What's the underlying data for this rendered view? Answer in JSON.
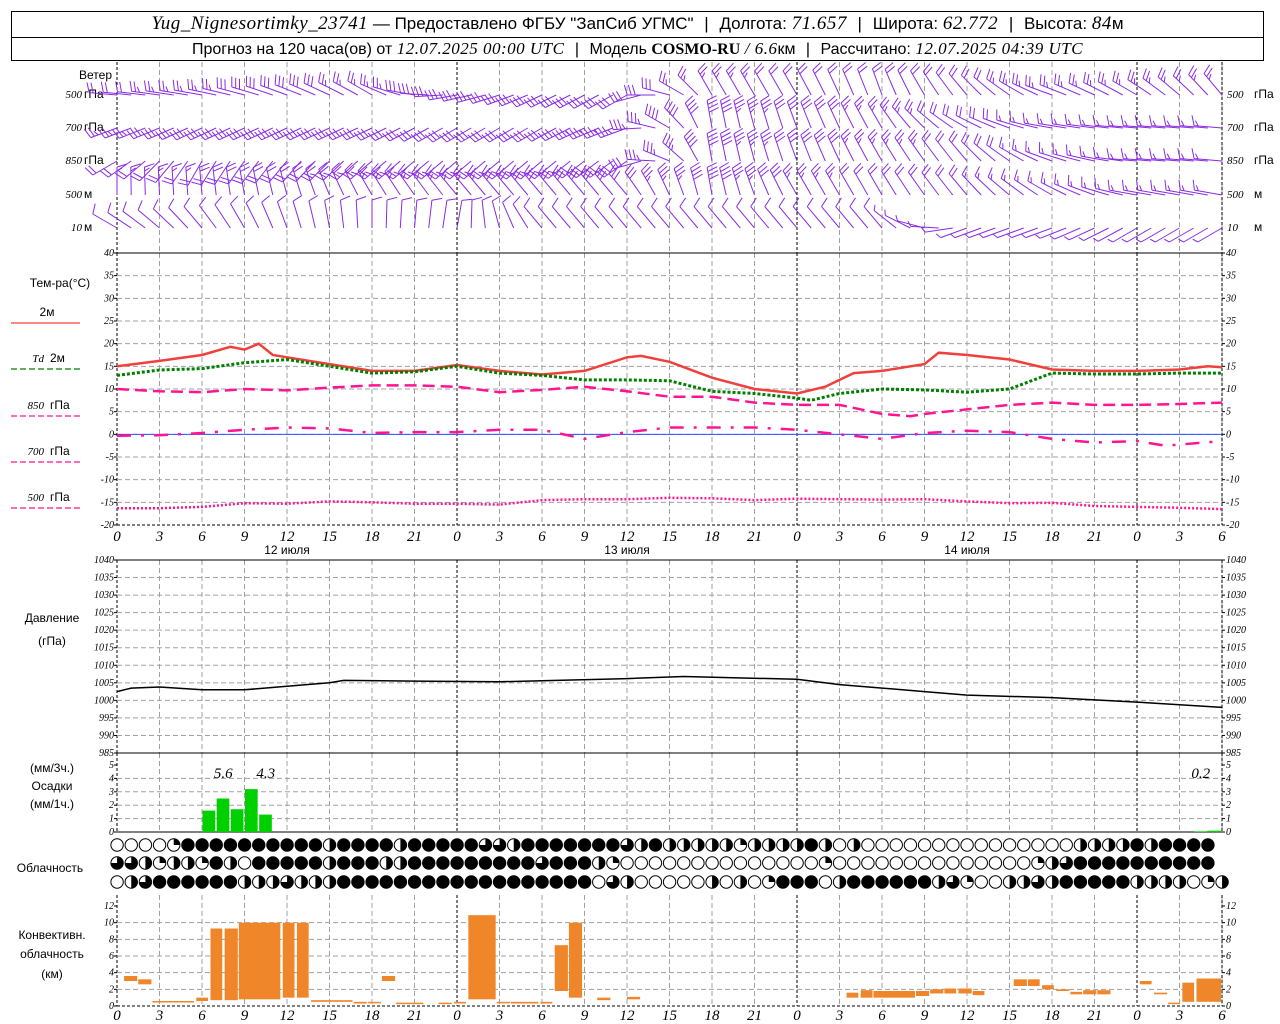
{
  "header": {
    "station": "Yug_Nignesortimky_23741",
    "provider": "— Предоставлено ФГБУ \"ЗапСиб УГМС\"",
    "lon_label": "Долгота:",
    "lon": "71.657",
    "lat_label": "Широта:",
    "lat": "62.772",
    "alt_label": "Высота:",
    "alt": "84",
    "alt_unit": "м",
    "forecast_prefix": "Прогноз на 120 часа(ов) от",
    "forecast_start": "12.07.2025 00:00 UTC",
    "model_label": "Модель",
    "model": "COSMO-RU",
    "model_res": "/ 6.6",
    "model_res_unit": "км",
    "calc_label": "Рассчитано:",
    "calc_time": "12.07.2025 04:39 UTC"
  },
  "labels": {
    "wind": "Ветер",
    "temp": "Тем-ра(°C)",
    "t2m": "2м",
    "td": "Td",
    "td2m": "2м",
    "p850": "850",
    "p700": "700",
    "p500": "500",
    "gpa": "гПа",
    "pressure": "Давление",
    "pressure_unit": "(гПа)",
    "precip_3h": "(мм/3ч.)",
    "precip": "Осадки",
    "precip_1h": "(мм/1ч.)",
    "clouds": "Облачность",
    "conv1": "Конвективн.",
    "conv2": "облачность",
    "conv3": "(км)"
  },
  "colors": {
    "wind": "#8a2be2",
    "t2m": "#f0403c",
    "td": "#008000",
    "upper": "#ff1493",
    "zero_line": "#3050ff",
    "precip": "#00d000",
    "convective": "#f0862a",
    "grid": "#a0a0a0"
  },
  "hour_ticks": [
    "0",
    "3",
    "6",
    "9",
    "12",
    "15",
    "18",
    "21",
    "0",
    "3",
    "6",
    "9",
    "12",
    "15",
    "18",
    "21",
    "0",
    "3",
    "6",
    "9",
    "12",
    "15",
    "18",
    "21",
    "0",
    "3",
    "6"
  ],
  "date_labels": [
    {
      "hour": 12,
      "text": "12 июля"
    },
    {
      "hour": 36,
      "text": "13 июля"
    },
    {
      "hour": 60,
      "text": "14 июля"
    }
  ],
  "chart_data": [
    {
      "type": "wind-barbs",
      "title": "Ветер",
      "x_hours_step": 6,
      "levels": [
        {
          "label_num": "500",
          "label_unit": "гПа",
          "dir": [
            275,
            280,
            290,
            300,
            260,
            245,
            240,
            330,
            330,
            340,
            320,
            290,
            300,
            320
          ],
          "speed": [
            8,
            10,
            12,
            10,
            12,
            12,
            12,
            10,
            8,
            7,
            8,
            10,
            10,
            10
          ]
        },
        {
          "label_num": "700",
          "label_unit": "гПа",
          "dir": [
            250,
            245,
            245,
            245,
            240,
            240,
            250,
            350,
            340,
            330,
            300,
            280,
            275,
            275
          ],
          "speed": [
            10,
            12,
            12,
            12,
            12,
            12,
            14,
            16,
            12,
            10,
            8,
            6,
            6,
            6
          ]
        },
        {
          "label_num": "850",
          "label_unit": "гПа",
          "dir": [
            240,
            210,
            220,
            230,
            230,
            230,
            235,
            350,
            340,
            330,
            320,
            290,
            275,
            275
          ],
          "speed": [
            8,
            8,
            8,
            10,
            10,
            10,
            12,
            16,
            12,
            10,
            8,
            6,
            6,
            6
          ]
        },
        {
          "label_num": "500",
          "label_unit": "м",
          "dir": [
            360,
            355,
            345,
            330,
            320,
            320,
            320,
            350,
            330,
            330,
            320,
            300,
            280,
            280
          ],
          "speed": [
            6,
            7,
            7,
            9,
            10,
            12,
            12,
            16,
            10,
            8,
            7,
            6,
            6,
            6
          ]
        },
        {
          "label_num": "10",
          "label_unit": "м",
          "dir": [
            300,
            320,
            340,
            360,
            370,
            320,
            320,
            320,
            320,
            320,
            250,
            250,
            240,
            240
          ],
          "speed": [
            3,
            3,
            3,
            4,
            4,
            3,
            4,
            4,
            3,
            3,
            2,
            2,
            2,
            2
          ]
        }
      ]
    },
    {
      "type": "line",
      "title": "Тем-ра(°C)",
      "ylim": [
        -20,
        40
      ],
      "yticks": [
        "40",
        "35",
        "30",
        "25",
        "20",
        "15",
        "10",
        "5",
        "0",
        "-5",
        "-10",
        "-15",
        "-20"
      ],
      "grid": true,
      "series": [
        {
          "name": "2м",
          "style": "solid",
          "x": [
            0,
            3,
            6,
            8,
            9,
            10,
            11,
            12,
            15,
            18,
            21,
            24,
            27,
            30,
            33,
            36,
            37,
            39,
            42,
            45,
            48,
            50,
            52,
            54,
            57,
            58,
            60,
            63,
            66,
            69,
            72,
            75,
            77,
            78
          ],
          "y": [
            15,
            16.2,
            17.5,
            19.3,
            18.7,
            20,
            17.5,
            17,
            15.5,
            14,
            14,
            15.3,
            14,
            13.2,
            14,
            17,
            17.3,
            16,
            12.5,
            10,
            9,
            10.5,
            13.5,
            14,
            15.5,
            18,
            17.5,
            16.5,
            14.3,
            14,
            14,
            14.3,
            15,
            14.8
          ]
        },
        {
          "name": "Td 2м",
          "style": "dotted",
          "x": [
            0,
            3,
            6,
            9,
            12,
            15,
            18,
            21,
            24,
            27,
            30,
            33,
            36,
            39,
            42,
            45,
            48,
            49,
            51,
            54,
            57,
            60,
            63,
            66,
            69,
            72,
            75,
            78
          ],
          "y": [
            13,
            14.2,
            14.5,
            15.8,
            16.5,
            15,
            13.5,
            13.8,
            15,
            13.5,
            13,
            12,
            12,
            11.8,
            9.5,
            9,
            8,
            7.5,
            9,
            10,
            9.8,
            9.3,
            10,
            13.5,
            13.3,
            13.3,
            13.5,
            13.5
          ]
        },
        {
          "name": "850 гПа",
          "style": "dashed",
          "x": [
            0,
            3,
            6,
            9,
            12,
            15,
            18,
            21,
            24,
            27,
            30,
            33,
            36,
            39,
            42,
            45,
            48,
            51,
            54,
            56,
            57,
            60,
            63,
            66,
            69,
            72,
            75,
            78
          ],
          "y": [
            10,
            9.5,
            9.3,
            10,
            9.7,
            10.3,
            10.8,
            10.8,
            10.5,
            9.3,
            9.8,
            10.5,
            9.5,
            8.3,
            8.3,
            7,
            6.5,
            6.5,
            4.5,
            4,
            4.5,
            5.5,
            6.5,
            7,
            6.5,
            6.5,
            6.7,
            7
          ]
        },
        {
          "name": "700 гПа",
          "style": "dashdot",
          "x": [
            0,
            3,
            6,
            9,
            12,
            15,
            18,
            21,
            24,
            27,
            30,
            33,
            36,
            39,
            42,
            45,
            48,
            51,
            54,
            57,
            60,
            63,
            66,
            69,
            72,
            74,
            78
          ],
          "y": [
            -0.3,
            -0.2,
            0.3,
            1,
            1.5,
            1.3,
            0.3,
            0.5,
            0.5,
            1,
            1,
            -1,
            0.5,
            1.5,
            1.5,
            1.5,
            1,
            0,
            -1,
            0.3,
            0.8,
            0.5,
            -1,
            -1.8,
            -1.5,
            -2.5,
            -1.5
          ]
        },
        {
          "name": "500 гПа",
          "style": "fine-dotted",
          "x": [
            0,
            3,
            6,
            9,
            12,
            15,
            18,
            21,
            24,
            27,
            30,
            33,
            36,
            39,
            42,
            45,
            48,
            51,
            54,
            57,
            60,
            63,
            66,
            69,
            72,
            75,
            78
          ],
          "y": [
            -16.3,
            -16.3,
            -16,
            -15.2,
            -15.3,
            -14.8,
            -15,
            -15.3,
            -15.3,
            -15.5,
            -14.5,
            -14.3,
            -14.3,
            -14,
            -14.1,
            -14.5,
            -14.2,
            -14.3,
            -14.4,
            -14.3,
            -14.8,
            -15.2,
            -15.1,
            -15.8,
            -16,
            -16.2,
            -16.5
          ]
        }
      ]
    },
    {
      "type": "line",
      "title": "Давление (гПа)",
      "ylim": [
        985,
        1040
      ],
      "yticks": [
        "1040",
        "1035",
        "1030",
        "1025",
        "1020",
        "1015",
        "1010",
        "1005",
        "1000",
        "995",
        "990",
        "985"
      ],
      "grid": true,
      "series": [
        {
          "x": [
            0,
            1,
            3,
            6,
            9,
            12,
            15,
            16,
            21,
            27,
            30,
            36,
            40,
            48,
            51,
            57,
            60,
            66,
            72,
            78
          ],
          "y": [
            1002.5,
            1003.5,
            1003.8,
            1003,
            1003,
            1004,
            1005,
            1005.7,
            1005.5,
            1005.3,
            1005.6,
            1006.2,
            1006.8,
            1006,
            1004.5,
            1002.5,
            1001.5,
            1000.8,
            999.5,
            998
          ]
        }
      ]
    },
    {
      "type": "bar",
      "title": "Осадки",
      "ylim": [
        0,
        5
      ],
      "yticks": [
        "5",
        "4",
        "3",
        "2",
        "1",
        "0"
      ],
      "bars_1h": [
        {
          "start": 6,
          "value": 1.6
        },
        {
          "start": 7,
          "value": 2.5
        },
        {
          "start": 8,
          "value": 1.7
        },
        {
          "start": 9,
          "value": 3.2
        },
        {
          "start": 10,
          "value": 1.3
        },
        {
          "start": 76,
          "value": 0.05
        },
        {
          "start": 77,
          "value": 0.1
        }
      ],
      "sums_3h": [
        {
          "hour": 7.5,
          "text": "5.6"
        },
        {
          "hour": 10.5,
          "text": "4.3"
        },
        {
          "hour": 76.5,
          "text": "0.2"
        }
      ]
    },
    {
      "type": "table",
      "title": "Облачность",
      "encoding": "okta per hour 0..78 (0 clear, 2 quarter, 4 half, 6 three-quarter, 8 overcast)",
      "rows": [
        "000028888888888488884888886648888888648444442444484040000000000000004444848888",
        "664244284088888488844888888888688842000000000000002000000000000002468888888888",
        "046888888444644488888888888888888806400000404028880488888846200446488888444402 4"
      ]
    },
    {
      "type": "bar",
      "title": "Конвективн. облачность (км)",
      "ylim": [
        0,
        12
      ],
      "yticks": [
        "12",
        "10",
        "8",
        "6",
        "4",
        "2",
        "0"
      ],
      "bars": [
        [
          0.5,
          1.5,
          3.0,
          3.6
        ],
        [
          1.5,
          2.5,
          2.6,
          3.2
        ],
        [
          2.5,
          5.5,
          0.5,
          0.6
        ],
        [
          5.6,
          6.5,
          0.6,
          1.0
        ],
        [
          6.6,
          7.5,
          0.7,
          9.3
        ],
        [
          7.6,
          8.6,
          0.7,
          9.3
        ],
        [
          8.6,
          11.6,
          0.8,
          10
        ],
        [
          11.7,
          12.6,
          1.0,
          10
        ],
        [
          12.7,
          13.6,
          1.0,
          10
        ],
        [
          13.7,
          16.7,
          0.5,
          0.7
        ],
        [
          16.7,
          17.7,
          0.3,
          0.5
        ],
        [
          17.7,
          18.7,
          0.4,
          0.5
        ],
        [
          18.7,
          19.7,
          3.0,
          3.6
        ],
        [
          19.7,
          21.7,
          0.3,
          0.4
        ],
        [
          22.7,
          23.7,
          0.3,
          0.4
        ],
        [
          23.8,
          24.7,
          0.3,
          0.5
        ],
        [
          24.8,
          26.8,
          0.8,
          10.9
        ],
        [
          26.8,
          27.8,
          0.4,
          0.5
        ],
        [
          27.8,
          29.8,
          0.3,
          0.5
        ],
        [
          29.9,
          30.8,
          0.3,
          0.5
        ],
        [
          30.9,
          31.9,
          1.8,
          7.3
        ],
        [
          31.9,
          32.9,
          1.0,
          10
        ],
        [
          33.9,
          34.9,
          0.7,
          1.0
        ],
        [
          36,
          37,
          0.8,
          1.1
        ],
        [
          51.5,
          52.4,
          1.0,
          1.6
        ],
        [
          52.5,
          53.4,
          1.0,
          1.9
        ],
        [
          53.4,
          56.4,
          1.0,
          1.8
        ],
        [
          56.4,
          57.4,
          1.2,
          1.8
        ],
        [
          57.4,
          58.4,
          1.5,
          2.0
        ],
        [
          58.4,
          59.3,
          1.5,
          2.1
        ],
        [
          59.4,
          60.4,
          1.5,
          2.1
        ],
        [
          60.4,
          61.3,
          1.3,
          1.8
        ],
        [
          63.3,
          64.3,
          2.4,
          3.2
        ],
        [
          64.3,
          65.2,
          2.4,
          3.2
        ],
        [
          65.3,
          66.2,
          2.0,
          2.5
        ],
        [
          66.3,
          67.3,
          1.8,
          2.0
        ],
        [
          67.3,
          68.2,
          1.4,
          1.7
        ],
        [
          68.2,
          69.2,
          1.4,
          1.9
        ],
        [
          69.2,
          70.2,
          1.4,
          1.9
        ],
        [
          72.2,
          73.1,
          2.6,
          3.0
        ],
        [
          73.2,
          74.2,
          1.4,
          1.6
        ],
        [
          74.2,
          75.1,
          0.3,
          0.4
        ],
        [
          75.2,
          76.1,
          0.5,
          2.8
        ],
        [
          76.2,
          78,
          0.5,
          3.3
        ]
      ]
    }
  ]
}
